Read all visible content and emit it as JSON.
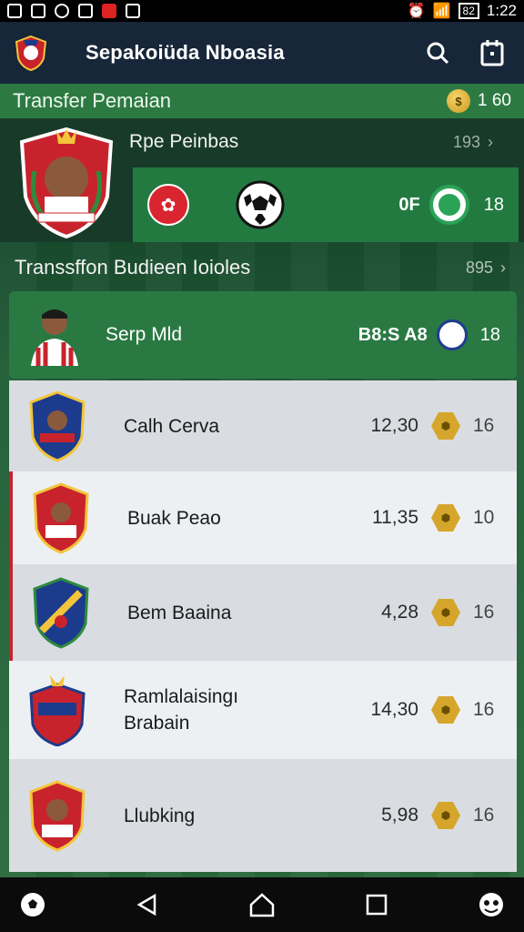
{
  "status_bar": {
    "time": "1:22",
    "battery": "82"
  },
  "app": {
    "title": "Sepakoiüda Nboasia"
  },
  "transfer": {
    "title": "Transfer Pemaian",
    "coins": "1 60"
  },
  "featured": {
    "name": "Rpe Peinbas",
    "count": "193",
    "stat_text": "0F",
    "number": "18"
  },
  "section": {
    "title": "Transsffon Budieen Ioioles",
    "count": "895"
  },
  "highlight": {
    "name": "Serp Mld",
    "club": "B8:S A8",
    "number": "18"
  },
  "players": [
    {
      "name": "Calh Cerva",
      "value": "12,30",
      "num": "16",
      "crest_color": "#1d3b8c"
    },
    {
      "name": "Buak Peao",
      "value": "11,35",
      "num": "10",
      "crest_color": "#c8232c"
    },
    {
      "name": "Bem Baaina",
      "value": "4,28",
      "num": "16",
      "crest_color": "#1d3b8c"
    },
    {
      "name": "Ramlalaisingı Brabain",
      "value": "14,30",
      "num": "16",
      "crest_color": "#c8232c"
    },
    {
      "name": "Llubking",
      "value": "5,98",
      "num": "16",
      "crest_color": "#c8232c"
    }
  ],
  "colors": {
    "appbar": "#172638",
    "strip_green": "#2c7a42",
    "accent_red": "#c8232c",
    "coin_gold": "#d6a62c"
  },
  "icons": [
    "search-icon",
    "calendar-icon",
    "back-icon",
    "home-icon",
    "recents-icon"
  ]
}
